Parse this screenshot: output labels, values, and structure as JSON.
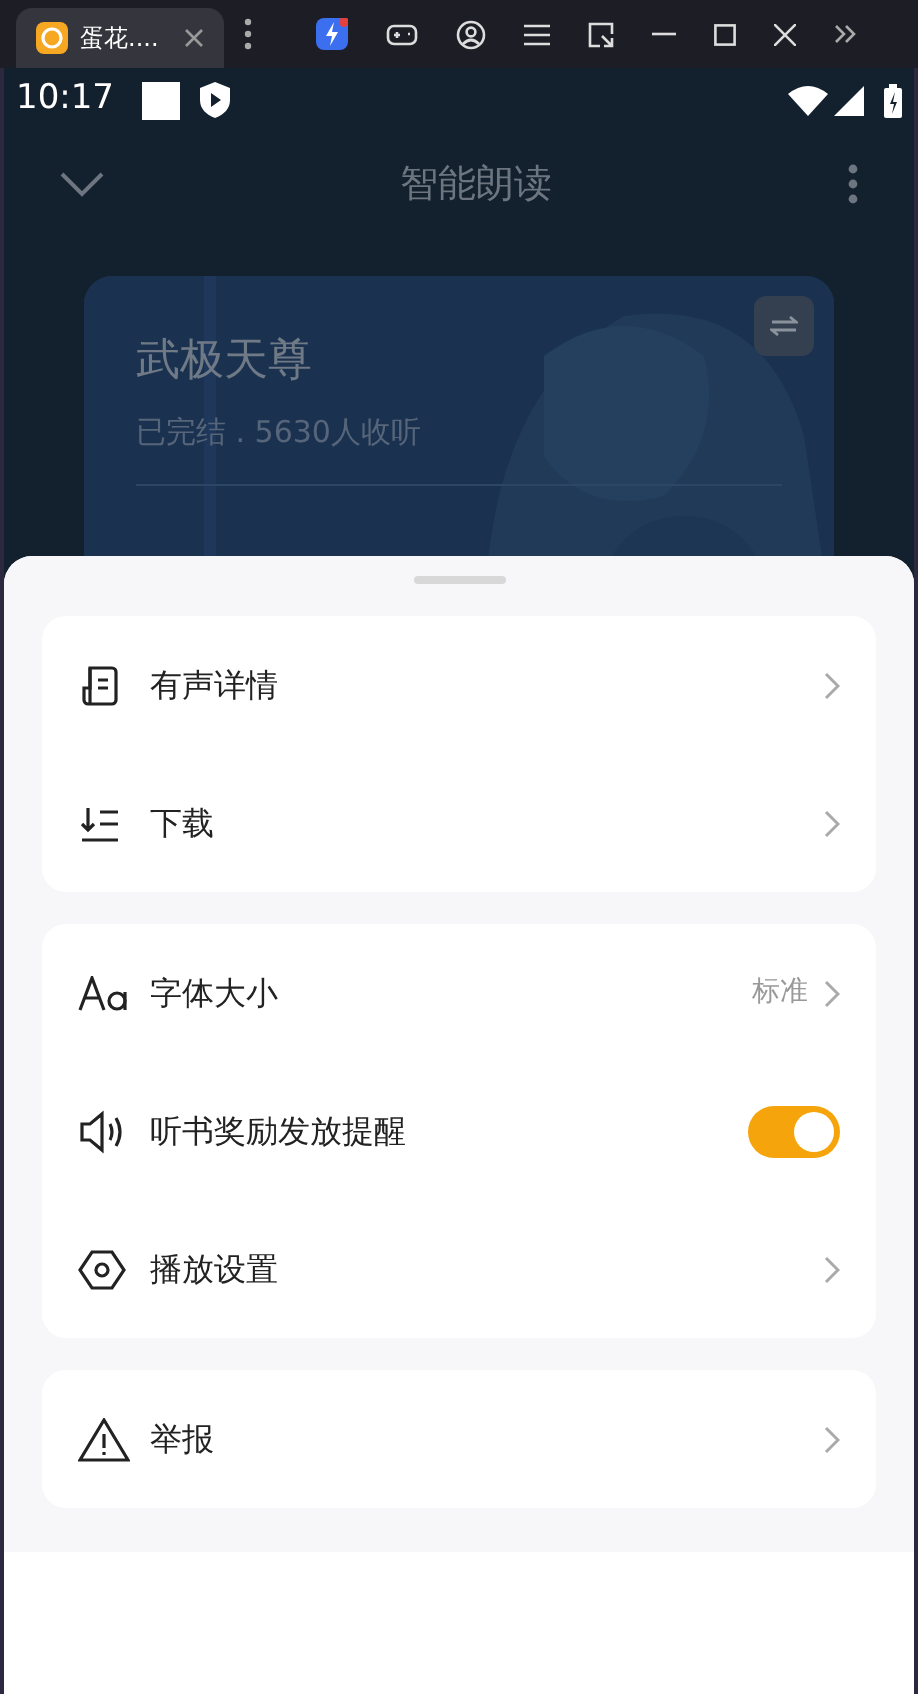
{
  "browser_tab": {
    "title": "蛋花...."
  },
  "status_bar": {
    "time": "10:17"
  },
  "header": {
    "title": "智能朗读"
  },
  "book": {
    "title": "武极天尊",
    "meta": "已完结 . 5630人收听"
  },
  "sheet": {
    "groups": [
      {
        "items": [
          {
            "kind": "link",
            "label": "有声详情"
          },
          {
            "kind": "link",
            "label": "下载"
          }
        ]
      },
      {
        "items": [
          {
            "kind": "link",
            "label": "字体大小",
            "value": "标准"
          },
          {
            "kind": "toggle",
            "label": "听书奖励发放提醒",
            "on": true
          },
          {
            "kind": "link",
            "label": "播放设置"
          }
        ]
      },
      {
        "items": [
          {
            "kind": "link",
            "label": "举报"
          }
        ]
      }
    ]
  }
}
